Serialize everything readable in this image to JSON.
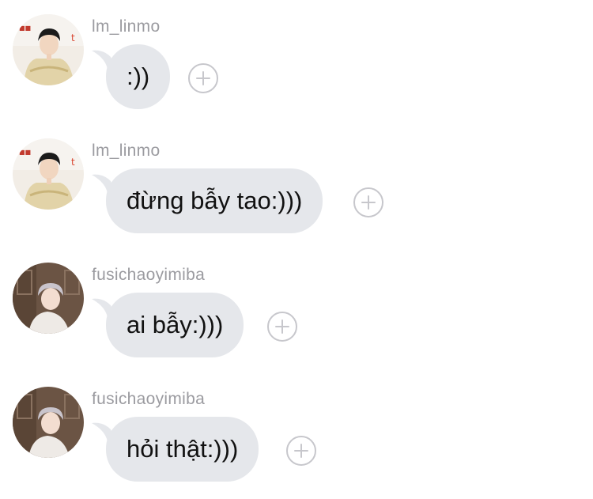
{
  "messages": [
    {
      "username": "lm_linmo",
      "text": ":))",
      "avatar_icon": "user-avatar-lm_linmo"
    },
    {
      "username": "lm_linmo",
      "text": "đừng bẫy tao:)))",
      "avatar_icon": "user-avatar-lm_linmo"
    },
    {
      "username": "fusichaoyimiba",
      "text": "ai bẫy:)))",
      "avatar_icon": "user-avatar-fusichaoyimiba"
    },
    {
      "username": "fusichaoyimiba",
      "text": "hỏi thật:)))",
      "avatar_icon": "user-avatar-fusichaoyimiba"
    }
  ],
  "colors": {
    "bubble": "#e5e7eb",
    "username": "#9b9ba0",
    "react_border": "#c7c7cc"
  },
  "icons": {
    "react": "plus-circle-icon"
  }
}
